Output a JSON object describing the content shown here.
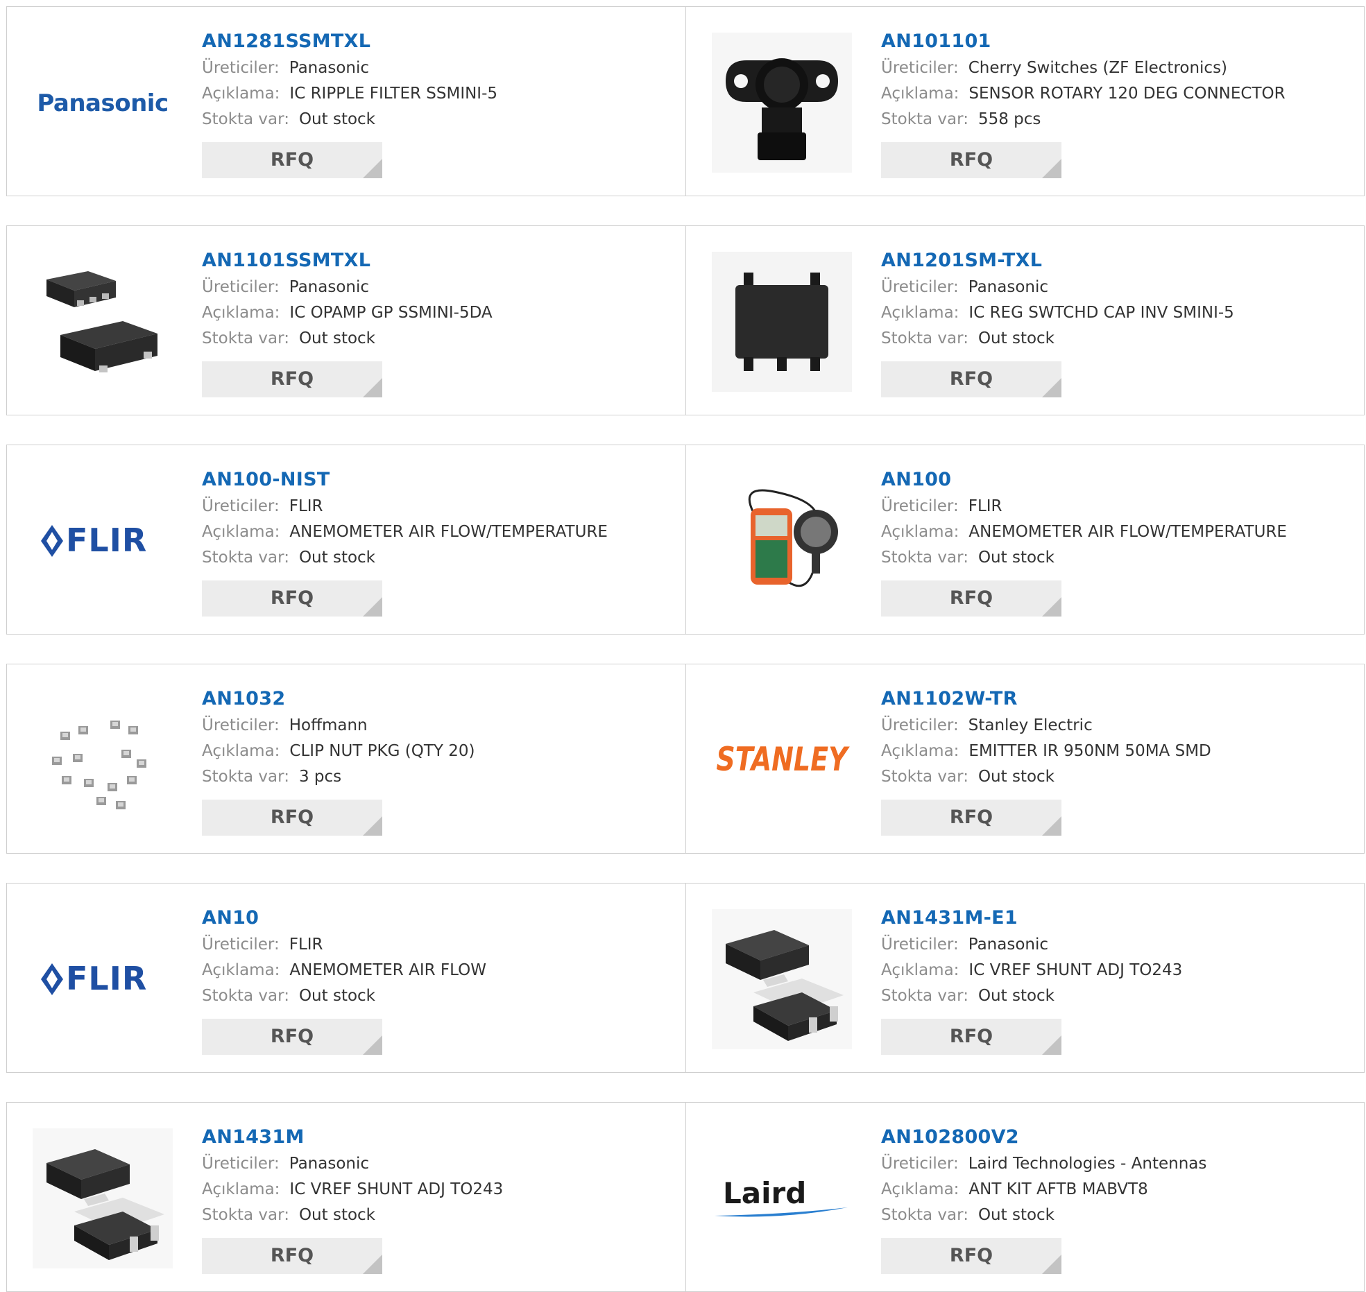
{
  "labels": {
    "manufacturer": "Üreticiler:",
    "description": "Açıklama:",
    "stock": "Stokta var:",
    "rfq": "RFQ"
  },
  "colors": {
    "part_link": "#1468b4",
    "label": "#8c8c8c",
    "value": "#333333",
    "rfq_bg": "#ececec",
    "border": "#cfcfcf"
  },
  "products": [
    {
      "part": "AN1281SSMTXL",
      "manufacturer": "Panasonic",
      "description": "IC RIPPLE FILTER SSMINI-5",
      "stock": "Out stock",
      "thumb": "panasonic-logo",
      "logo_text": "Panasonic"
    },
    {
      "part": "AN101101",
      "manufacturer": "Cherry Switches (ZF Electronics)",
      "description": "SENSOR ROTARY 120 DEG CONNECTOR",
      "stock": "558 pcs",
      "thumb": "rotary-sensor-image"
    },
    {
      "part": "AN1101SSMTXL",
      "manufacturer": "Panasonic",
      "description": "IC OPAMP GP SSMINI-5DA",
      "stock": "Out stock",
      "thumb": "smd-chip-image"
    },
    {
      "part": "AN1201SM-TXL",
      "manufacturer": "Panasonic",
      "description": "IC REG SWTCHD CAP INV SMINI-5",
      "stock": "Out stock",
      "thumb": "ic-chip-image"
    },
    {
      "part": "AN100-NIST",
      "manufacturer": "FLIR",
      "description": "ANEMOMETER AIR FLOW/TEMPERATURE",
      "stock": "Out stock",
      "thumb": "flir-logo",
      "logo_text": "FLIR"
    },
    {
      "part": "AN100",
      "manufacturer": "FLIR",
      "description": "ANEMOMETER AIR FLOW/TEMPERATURE",
      "stock": "Out stock",
      "thumb": "anemometer-image"
    },
    {
      "part": "AN1032",
      "manufacturer": "Hoffmann",
      "description": "CLIP NUT PKG (QTY 20)",
      "stock": "3 pcs",
      "thumb": "clip-nuts-image"
    },
    {
      "part": "AN1102W-TR",
      "manufacturer": "Stanley Electric",
      "description": "EMITTER IR 950NM 50MA SMD",
      "stock": "Out stock",
      "thumb": "stanley-logo",
      "logo_text": "STANLEY"
    },
    {
      "part": "AN10",
      "manufacturer": "FLIR",
      "description": "ANEMOMETER AIR FLOW",
      "stock": "Out stock",
      "thumb": "flir-logo",
      "logo_text": "FLIR"
    },
    {
      "part": "AN1431M-E1",
      "manufacturer": "Panasonic",
      "description": "IC VREF SHUNT ADJ TO243",
      "stock": "Out stock",
      "thumb": "to243-package-image"
    },
    {
      "part": "AN1431M",
      "manufacturer": "Panasonic",
      "description": "IC VREF SHUNT ADJ TO243",
      "stock": "Out stock",
      "thumb": "to243-package-image"
    },
    {
      "part": "AN102800V2",
      "manufacturer": "Laird Technologies - Antennas",
      "description": "ANT KIT AFTB MABVT8",
      "stock": "Out stock",
      "thumb": "laird-logo",
      "logo_text": "Laird"
    }
  ]
}
